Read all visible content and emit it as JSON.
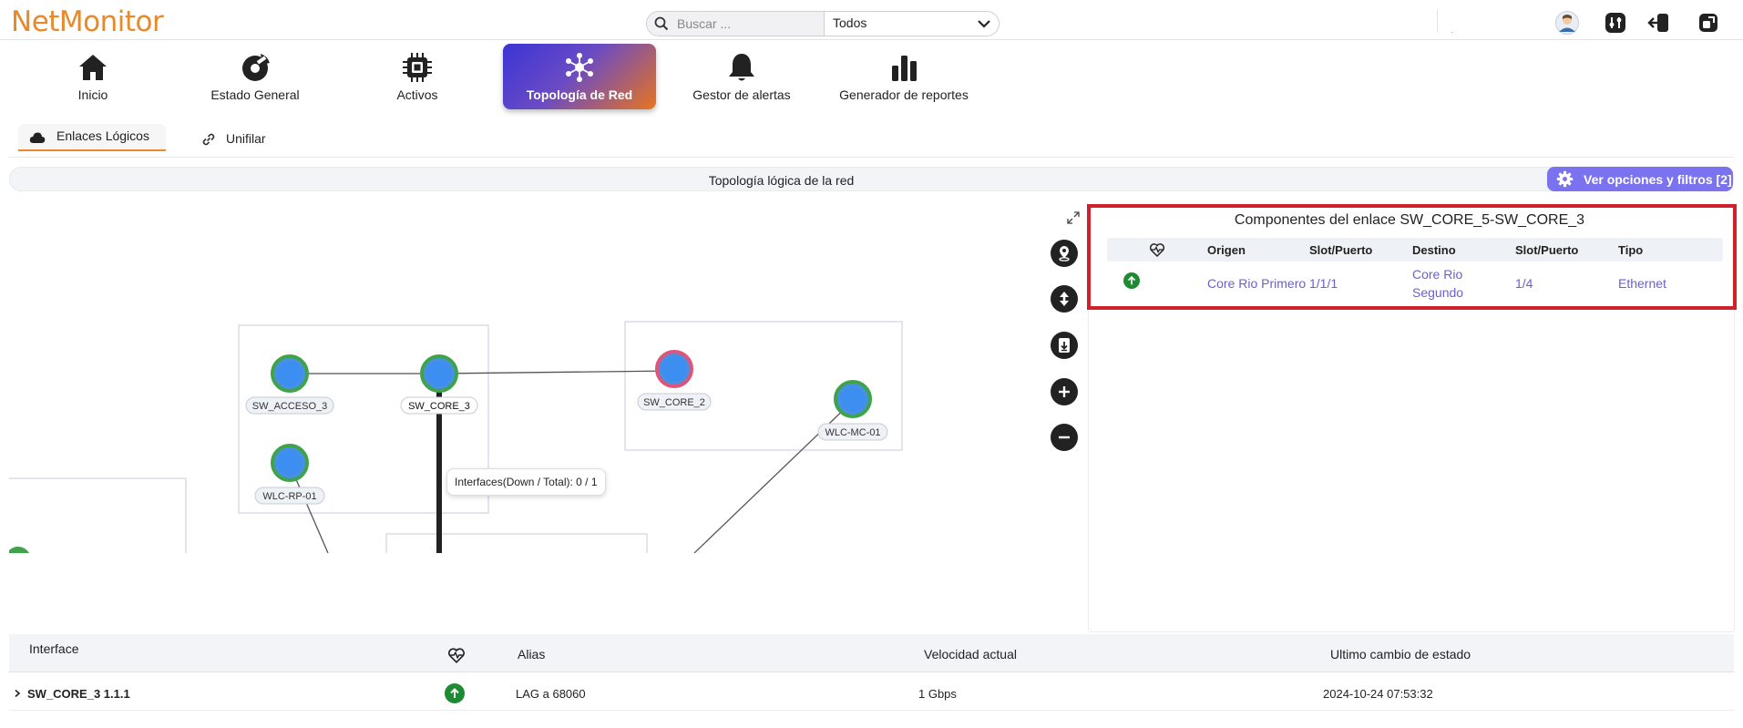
{
  "app": {
    "logo": "NetMonitor"
  },
  "search": {
    "placeholder": "Buscar ...",
    "scope": "Todos"
  },
  "header": {
    "user_dot": "."
  },
  "nav": {
    "items": [
      {
        "label": "Inicio",
        "icon": "home-icon"
      },
      {
        "label": "Estado General",
        "icon": "dashboard-icon"
      },
      {
        "label": "Activos",
        "icon": "chip-icon"
      },
      {
        "label": "Topología de Red",
        "icon": "topology-icon",
        "active": true
      },
      {
        "label": "Gestor de alertas",
        "icon": "bell-icon"
      },
      {
        "label": "Generador de reportes",
        "icon": "bar-chart-icon"
      }
    ]
  },
  "subtabs": [
    {
      "label": "Enlaces Lógicos",
      "icon": "cloud-icon",
      "active": true
    },
    {
      "label": "Unifilar",
      "icon": "link-icon"
    }
  ],
  "topology": {
    "title": "Topología lógica de la red",
    "filters_label": "Ver opciones y filtros [2]",
    "nodes": [
      {
        "label": "SW_ACCESO_3",
        "status": "up"
      },
      {
        "label": "SW_CORE_3",
        "status": "up"
      },
      {
        "label": "SW_CORE_2",
        "status": "down"
      },
      {
        "label": "WLC-MC-01",
        "status": "up"
      },
      {
        "label": "WLC-RP-01",
        "status": "up"
      }
    ],
    "tooltip": "Interfaces(Down / Total): 0 / 1"
  },
  "components": {
    "title": "Componentes del enlace SW_CORE_5-SW_CORE_3",
    "headers": {
      "origin": "Origen",
      "slot1": "Slot/Puerto",
      "dest": "Destino",
      "slot2": "Slot/Puerto",
      "type": "Tipo"
    },
    "rows": [
      {
        "origin": "Core Rio Primero",
        "slot1": "1/1/1",
        "dest_line1": "Core Rio",
        "dest_line2": "Segundo",
        "slot2": "1/4",
        "type": "Ethernet"
      }
    ]
  },
  "interfaces_table": {
    "headers": {
      "interface": "Interface",
      "alias": "Alias",
      "speed": "Velocidad actual",
      "last_change": "Ultimo cambio de estado"
    },
    "rows": [
      {
        "interface": "SW_CORE_3 1.1.1",
        "alias": "LAG a 68060",
        "speed": "1 Gbps",
        "last_change": "2024-10-24 07:53:32"
      }
    ]
  },
  "colors": {
    "accent": "#e8892b",
    "primary": "#7b72f0",
    "link": "#6a5fd1",
    "status_up": "#1e8a32",
    "status_down": "#e0547a",
    "highlight": "#d0212a"
  }
}
